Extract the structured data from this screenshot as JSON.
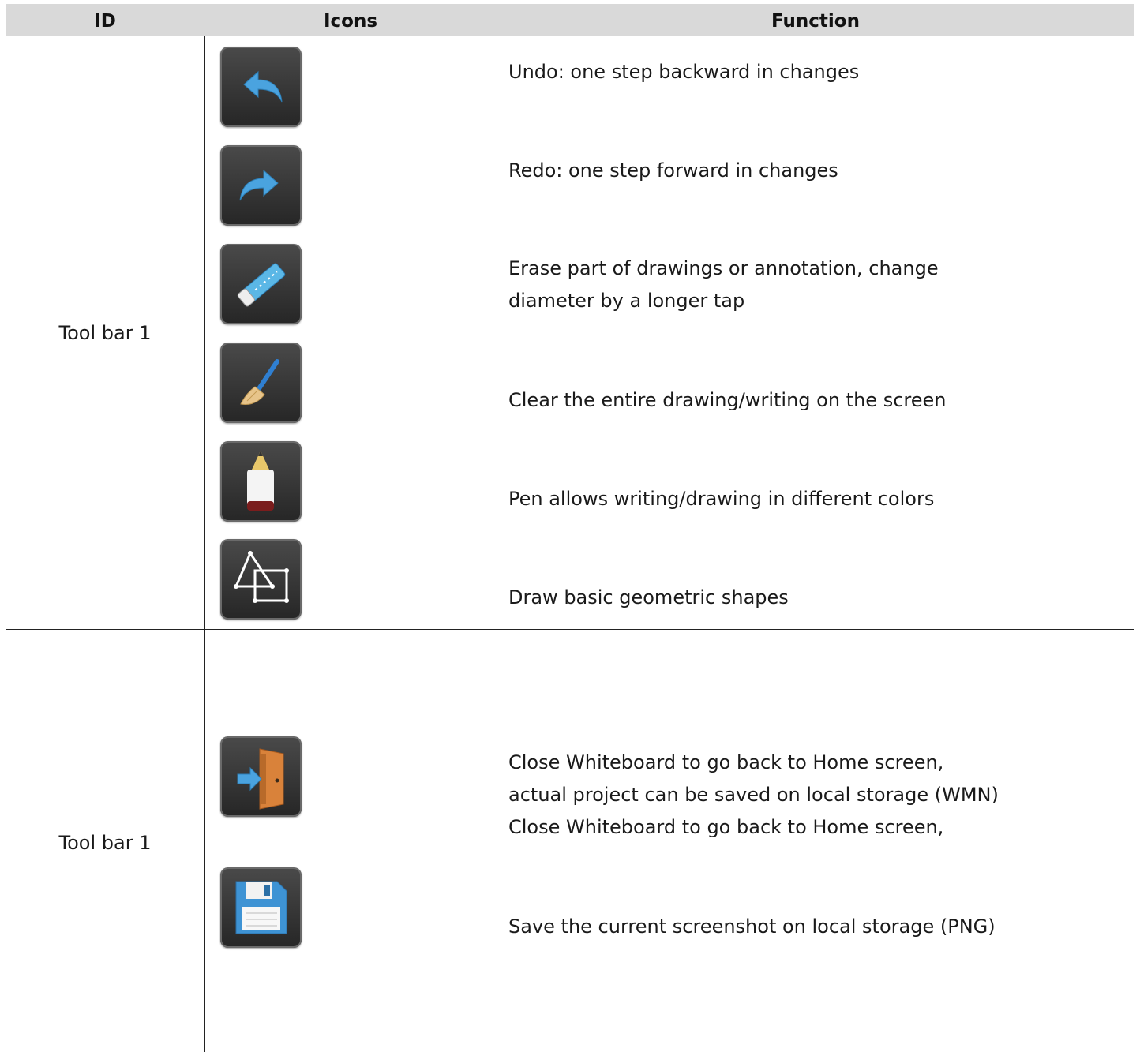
{
  "table": {
    "headers": {
      "id": "ID",
      "icons": "Icons",
      "function": "Function"
    },
    "groups": [
      {
        "id": "Tool bar 1"
      },
      {
        "id": "Tool bar 1"
      }
    ],
    "rows": [
      {
        "icon": "undo-icon",
        "function": "Undo: one step backward in changes"
      },
      {
        "icon": "redo-icon",
        "function": "Redo: one step forward in changes"
      },
      {
        "icon": "eraser-icon",
        "function": "Erase part of drawings or annotation, change\ndiameter by a longer tap"
      },
      {
        "icon": "broom-icon",
        "function": "Clear the entire drawing/writing on the screen"
      },
      {
        "icon": "pen-icon",
        "function": "Pen allows writing/drawing in different colors"
      },
      {
        "icon": "shapes-icon",
        "function": "Draw basic geometric shapes"
      },
      {
        "icon": "exit-door-icon",
        "function": "Close Whiteboard to go back to Home screen,\nactual project can be saved on local storage (WMN)\nClose Whiteboard to go back to Home screen,"
      },
      {
        "icon": "save-floppy-icon",
        "function": "Save the current screenshot on local storage (PNG)"
      }
    ]
  },
  "colors": {
    "header_bg": "#d9d9d9",
    "icon_bg": "#333333",
    "arrow_blue": "#4aa3df"
  }
}
